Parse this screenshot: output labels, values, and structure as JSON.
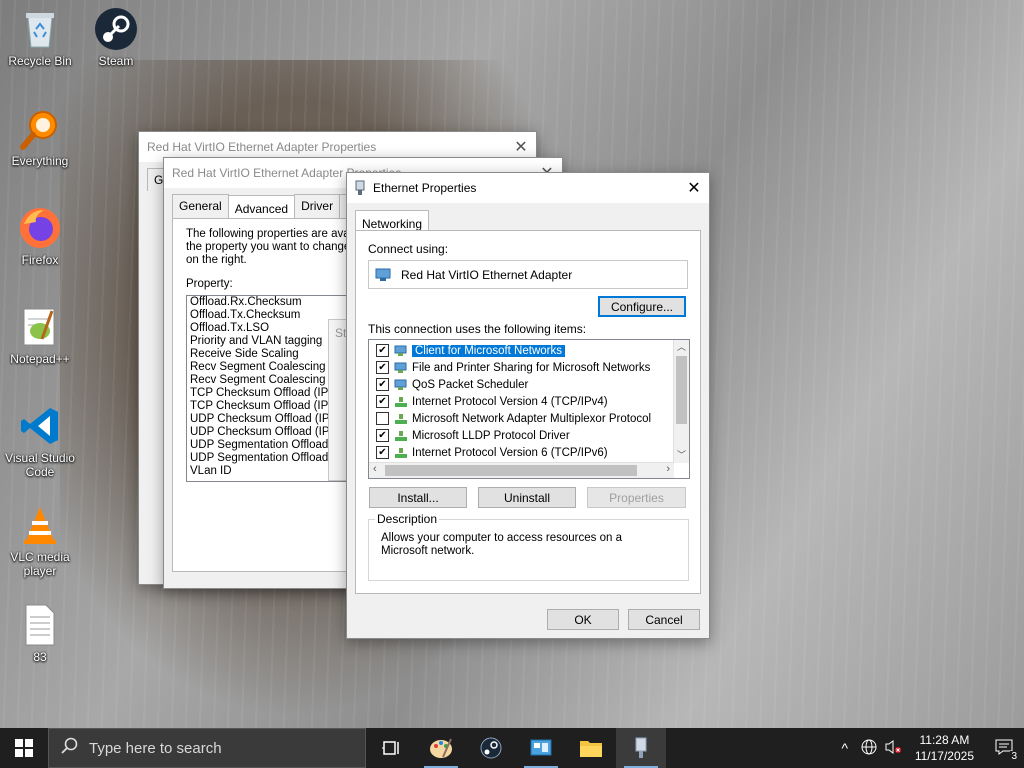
{
  "desktop": {
    "icons": [
      {
        "label": "Recycle Bin",
        "icon": "recycle-bin-icon"
      },
      {
        "label": "Steam",
        "icon": "steam-icon"
      },
      {
        "label": "Everything",
        "icon": "everything-search-icon"
      },
      {
        "label": "Firefox",
        "icon": "firefox-icon"
      },
      {
        "label": "Notepad++",
        "icon": "notepad-plus-plus-icon"
      },
      {
        "label": "Visual Studio Code",
        "icon": "vscode-icon"
      },
      {
        "label": "VLC media player",
        "icon": "vlc-icon"
      },
      {
        "label": "83",
        "icon": "text-file-icon"
      }
    ]
  },
  "back_window": {
    "title": "Red Hat VirtIO Ethernet Adapter Properties",
    "tab_partial": "Gen"
  },
  "mid_window": {
    "title": "Red Hat VirtIO Ethernet Adapter Properties",
    "tabs": [
      "General",
      "Advanced",
      "Driver",
      "Det"
    ],
    "active_tab": "Advanced",
    "description": "The following properties are available for this network adapter. Click the property you want to change on the left, and then select its value on the right.",
    "description_lines": [
      "The following properties are availa",
      "the property you want to change o",
      "on the right."
    ],
    "property_label": "Property:",
    "properties": [
      "Offload.Rx.Checksum",
      "Offload.Tx.Checksum",
      "Offload.Tx.LSO",
      "Priority and VLAN tagging",
      "Receive Side Scaling",
      "Recv Segment Coalescing (",
      "Recv Segment Coalescing (",
      "TCP Checksum Offload (IPv",
      "TCP Checksum Offload (IPv",
      "UDP Checksum Offload (IP",
      "UDP Checksum Offload (IP",
      "UDP Segmentation Offload (I",
      "UDP Segmentation Offload (I",
      "VLan ID"
    ],
    "partial_frame_text": "St"
  },
  "ethernet_dialog": {
    "title": "Ethernet Properties",
    "tab": "Networking",
    "connect_using_label": "Connect using:",
    "adapter_name": "Red Hat VirtIO Ethernet Adapter",
    "configure_button": "Configure...",
    "items_label": "This connection uses the following items:",
    "items": [
      {
        "label": "Client for Microsoft Networks",
        "checked": "✔",
        "selected": true
      },
      {
        "label": "File and Printer Sharing for Microsoft Networks",
        "checked": "✔"
      },
      {
        "label": "QoS Packet Scheduler",
        "checked": "✔"
      },
      {
        "label": "Internet Protocol Version 4 (TCP/IPv4)",
        "checked": "✔"
      },
      {
        "label": "Microsoft Network Adapter Multiplexor Protocol",
        "checked": ""
      },
      {
        "label": "Microsoft LLDP Protocol Driver",
        "checked": "✔"
      },
      {
        "label": "Internet Protocol Version 6 (TCP/IPv6)",
        "checked": "✔"
      }
    ],
    "install_button": "Install...",
    "uninstall_button": "Uninstall",
    "properties_button": "Properties",
    "description_group_label": "Description",
    "description_text": "Allows your computer to access resources on a Microsoft network.",
    "ok_button": "OK",
    "cancel_button": "Cancel"
  },
  "taskbar": {
    "search_placeholder": "Type here to search",
    "time": "11:28 AM",
    "date": "11/17/2025",
    "notification_count": "3"
  },
  "colors": {
    "accent": "#0078d7",
    "taskbar": "#1f1f1f"
  }
}
